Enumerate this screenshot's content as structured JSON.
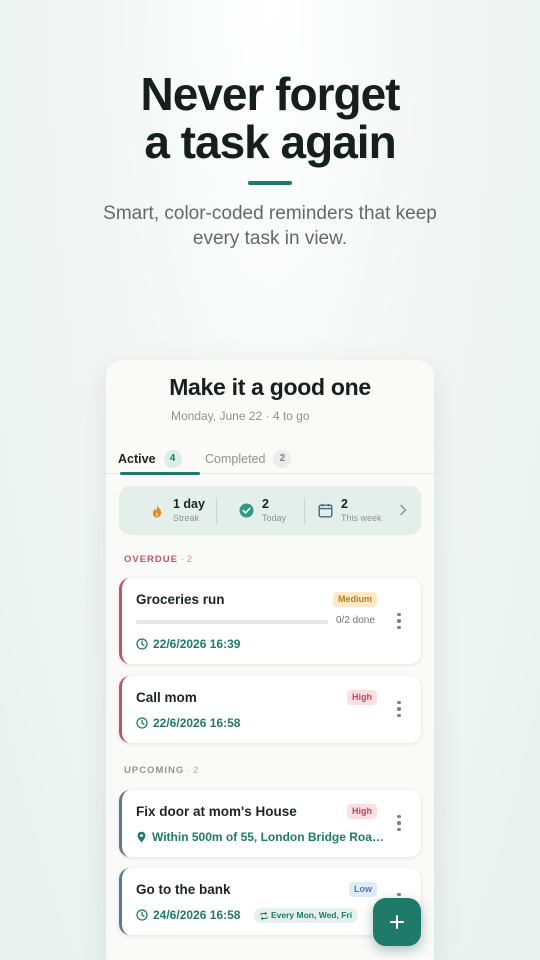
{
  "hero": {
    "title_line1": "Never forget",
    "title_line2": "a task again",
    "subtitle_line1": "Smart, color-coded reminders that keep",
    "subtitle_line2": "every task in view."
  },
  "app": {
    "title": "Make it a good one",
    "date_line": "Monday, June 22 · 4 to go",
    "tabs": [
      {
        "label": "Active",
        "count": "4",
        "active": true
      },
      {
        "label": "Completed",
        "count": "2",
        "active": false
      }
    ],
    "stats": [
      {
        "value": "1 day",
        "label": "Streak",
        "icon": "flame-icon"
      },
      {
        "value": "2",
        "label": "Today",
        "icon": "check-circle-icon"
      },
      {
        "value": "2",
        "label": "This week",
        "icon": "calendar-icon"
      }
    ],
    "sections": {
      "overdue": {
        "label": "OVERDUE",
        "count": "· 2"
      },
      "upcoming": {
        "label": "UPCOMING",
        "count": "· 2"
      }
    },
    "tasks": [
      {
        "title": "Groceries run",
        "priority": "Medium",
        "progress_text": "0/2 done",
        "progress": 0,
        "meta": "22/6/2026 16:39",
        "meta_icon": "clock-icon"
      },
      {
        "title": "Call mom",
        "priority": "High",
        "meta": "22/6/2026 16:58",
        "meta_icon": "clock-icon"
      },
      {
        "title": "Fix door at mom's House",
        "priority": "High",
        "meta": "Within 500m of 55, London Bridge Roa…",
        "meta_icon": "location-pin-icon"
      },
      {
        "title": "Go to the bank",
        "priority": "Low",
        "meta": "24/6/2026 16:58",
        "meta_icon": "clock-icon",
        "repeat": "Every Mon, Wed, Fri"
      }
    ]
  },
  "colors": {
    "accent": "#1f7a6a",
    "overdue": "#c2546a",
    "upcoming": "#5a7a92",
    "medium": "#b7811e",
    "high": "#c04a5e",
    "low": "#4a78c0"
  }
}
